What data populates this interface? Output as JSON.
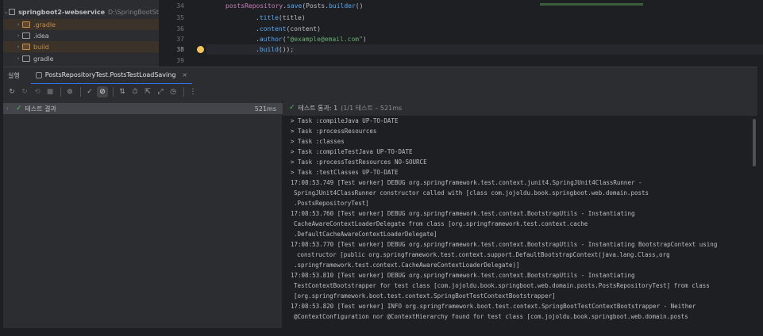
{
  "project": {
    "root": {
      "name": "springboot2-webservice",
      "path": "D:\\SpringBootSt"
    },
    "items": [
      {
        "label": ".gradle",
        "style": "excluded"
      },
      {
        "label": ".idea",
        "style": "normal"
      },
      {
        "label": "build",
        "style": "excluded"
      },
      {
        "label": "gradle",
        "style": "normal"
      }
    ]
  },
  "editor": {
    "lines": [
      {
        "num": "34",
        "code": "        postsRepository.save(Posts.builder()"
      },
      {
        "num": "35",
        "code": "                .title(title)"
      },
      {
        "num": "36",
        "code": "                .content(content)"
      },
      {
        "num": "37",
        "code": "                .author(\"@example@email.com\")"
      },
      {
        "num": "38",
        "code": "                .build());"
      },
      {
        "num": "39",
        "code": ""
      }
    ]
  },
  "run": {
    "title": "실행",
    "tab_label": "PostsRepositoryTest.PostsTestLoadSaving",
    "tab_close": "×"
  },
  "tree": {
    "result_label": "테스트 결과",
    "result_duration": "521ms"
  },
  "console_header": {
    "passed": "테스트 통과: 1",
    "rest": "(1/1 테스트 – 521ms"
  },
  "console": [
    {
      "t": "> Task :compileJava UP-TO-DATE",
      "c": ""
    },
    {
      "t": "> Task :processResources",
      "c": ""
    },
    {
      "t": "> Task :classes",
      "c": ""
    },
    {
      "t": "> Task :compileTestJava UP-TO-DATE",
      "c": ""
    },
    {
      "t": "> Task :processTestResources NO-SOURCE",
      "c": ""
    },
    {
      "t": "> Task :testClasses UP-TO-DATE",
      "c": ""
    },
    {
      "t": "17:08:53.749 [Test worker] DEBUG org.springframework.test.context.junit4.SpringJUnit4ClassRunner -",
      "c": ""
    },
    {
      "t": "SpringJUnit4ClassRunner constructor called with [class com.jojoldu.book.springboot.web.domain.posts",
      "c": "indent"
    },
    {
      "t": ".PostsRepositoryTest]",
      "c": "indent"
    },
    {
      "t": "17:08:53.760 [Test worker] DEBUG org.springframework.test.context.BootstrapUtils - Instantiating",
      "c": ""
    },
    {
      "t": "CacheAwareContextLoaderDelegate from class [org.springframework.test.context.cache",
      "c": "indent"
    },
    {
      "t": ".DefaultCacheAwareContextLoaderDelegate]",
      "c": "indent"
    },
    {
      "t": "17:08:53.770 [Test worker] DEBUG org.springframework.test.context.BootstrapUtils - Instantiating BootstrapContext using",
      "c": ""
    },
    {
      "t": "constructor [public org.springframework.test.context.support.DefaultBootstrapContext(java.lang.Class,org",
      "c": "indent2"
    },
    {
      "t": ".springframework.test.context.CacheAwareContextLoaderDelegate)]",
      "c": "indent"
    },
    {
      "t": "17:08:53.810 [Test worker] DEBUG org.springframework.test.context.BootstrapUtils - Instantiating",
      "c": ""
    },
    {
      "t": "TestContextBootstrapper for test class [com.jojoldu.book.springboot.web.domain.posts.PostsRepositoryTest] from class",
      "c": "indent"
    },
    {
      "t": "[org.springframework.boot.test.context.SpringBootTestContextBootstrapper]",
      "c": "indent"
    },
    {
      "t": "17:08:53.820 [Test worker] INFO org.springframework.boot.test.context.SpringBootTestContextBootstrapper - Neither",
      "c": ""
    },
    {
      "t": "@ContextConfiguration nor @ContextHierarchy found for test class [com.jojoldu.book.springboot.web.domain.posts",
      "c": "indent"
    }
  ],
  "icons": {
    "rerun": "rerun-icon",
    "stop": "stop-icon",
    "passed_filter": "check-icon",
    "ignored_filter": "no-entry-icon"
  }
}
